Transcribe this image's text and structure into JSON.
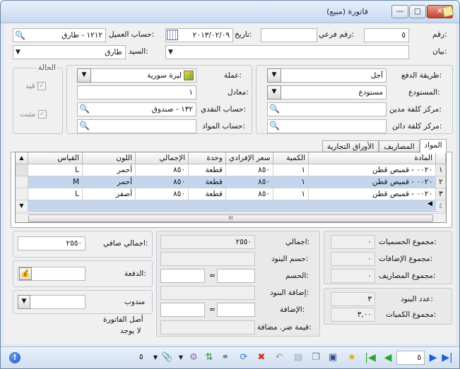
{
  "window": {
    "title": "فاتورة (مبيع)"
  },
  "header": {
    "number_label": "رقم:",
    "number_value": "٥",
    "subnumber_label": "رقم فرعي:",
    "subnumber_value": "",
    "date_label": "تاريخ:",
    "date_value": "٢٠١٣/٠٢/٠٩",
    "client_account_label": "حساب العميل:",
    "client_account_value": "١٢١٢ - طارق",
    "statement_label": "بيان:",
    "statement_value": "",
    "sir_label": "السيد:",
    "sir_value": "طارق"
  },
  "payment": {
    "method_label": "طريقة الدفع:",
    "method_value": "آجل",
    "warehouse_label": "المستودع:",
    "warehouse_value": "مستودع",
    "debit_cost_label": "مركز كلفة مدين:",
    "debit_cost_value": "",
    "credit_cost_label": "مركز كلفة دائن:",
    "credit_cost_value": ""
  },
  "currency": {
    "currency_label": "عملة:",
    "currency_value": "ليرة سورية",
    "rate_label": "معادل:",
    "rate_value": "١",
    "cash_account_label": "حساب النقدي:",
    "cash_account_value": "١٣٢ - صندوق",
    "materials_account_label": "حساب المواد:",
    "materials_account_value": ""
  },
  "status": {
    "title": "الحالة",
    "posted_label": "قيد",
    "approved_label": "مثبت"
  },
  "tabs": [
    "المواد",
    "المصاريف",
    "الأوراق التجارية"
  ],
  "grid": {
    "columns": [
      "المادة",
      "الكمية",
      "سعر الإفرادي",
      "وحدة",
      "الإجمالي",
      "اللون",
      "القياس"
    ],
    "rows": [
      {
        "num": "١",
        "item": "٠٠٢٠ - قميص قطن",
        "qty": "١",
        "price": "٨٥٠",
        "unit": "قطعة",
        "total": "٨٥٠",
        "color": "أحمر",
        "size": "L"
      },
      {
        "num": "٢",
        "item": "٠٠٢٠ - قميص قطن",
        "qty": "١",
        "price": "٨٥٠",
        "unit": "قطعة",
        "total": "٨٥٠",
        "color": "أحمر",
        "size": "M"
      },
      {
        "num": "٣",
        "item": "٠٠٢٠ - قميص قطن",
        "qty": "١",
        "price": "٨٥٠",
        "unit": "قطعة",
        "total": "٨٥٠",
        "color": "أصفر",
        "size": "L"
      },
      {
        "num": "٤",
        "item": "",
        "qty": "",
        "price": "",
        "unit": "",
        "total": "",
        "color": "",
        "size": ""
      }
    ],
    "scroll_mid": "III"
  },
  "totals_left": {
    "discounts_label": "مجموع الحسميات:",
    "discounts_value": "٠",
    "additions_label": "مجموع الإضافات:",
    "additions_value": "٠",
    "expenses_label": "مجموع المصاريف:",
    "expenses_value": "٠",
    "items_count_label": "عدد البنود:",
    "items_count_value": "٣",
    "qty_total_label": "مجموع الكميات:",
    "qty_total_value": "٣,٠٠"
  },
  "totals_mid": {
    "total_label": "اجمالي:",
    "total_value": "٢٥٥٠",
    "items_discount_label": "حسم البنود:",
    "items_discount_value": "",
    "discount_label": "الحسم:",
    "discount_eq": "=",
    "items_addition_label": "إضافة البنود:",
    "items_addition_value": "",
    "addition_label": "الإضافة:",
    "addition_eq": "=",
    "vat_label": "قيمة ضر. مضافة:",
    "vat_value": ""
  },
  "totals_right": {
    "net_label": "اجمالي صافي:",
    "net_value": "٢٥٥٠",
    "payment_label": "الدفعة:",
    "delegate_label": "مندوب",
    "origin_label": "أصل الفاتورة",
    "origin_value": "لا يوجد"
  },
  "toolbar": {
    "page_value": "٥",
    "attach_count": "٥"
  }
}
